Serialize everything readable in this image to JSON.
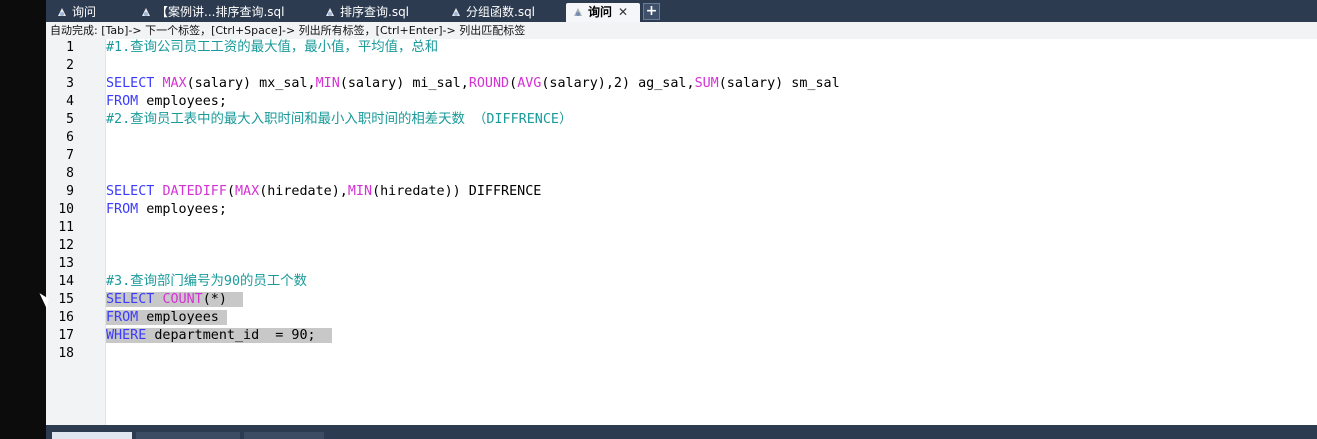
{
  "tabs": [
    {
      "label": "询问",
      "icon": "query-file-icon"
    },
    {
      "label": "【案例讲...排序查询.sql",
      "icon": "query-file-icon"
    },
    {
      "label": "排序查询.sql",
      "icon": "query-file-icon"
    },
    {
      "label": "分组函数.sql",
      "icon": "query-file-icon"
    },
    {
      "label": "询问",
      "icon": "query-file-icon",
      "active": true,
      "close": "✕"
    }
  ],
  "new_tab_label": "+",
  "hint_bar": "自动完成: [Tab]-> 下一个标签，[Ctrl+Space]-> 列出所有标签，[Ctrl+Enter]-> 列出匹配标签",
  "editor": {
    "line_numbers": [
      "1",
      "2",
      "3",
      "4",
      "5",
      "6",
      "7",
      "8",
      "9",
      "10",
      "11",
      "12",
      "13",
      "14",
      "15",
      "16",
      "17",
      "18"
    ],
    "lines": {
      "l1": "#1.查询公司员工工资的最大值，最小值，平均值，总和",
      "l3": {
        "kw": "SELECT ",
        "f1": "MAX",
        "t1": "(salary) mx_sal,",
        "f2": "MIN",
        "t2": "(salary) mi_sal,",
        "f3": "ROUND",
        "t3": "(",
        "f4": "AVG",
        "t4": "(salary),2) ag_sal,",
        "f5": "SUM",
        "t5": "(salary) sm_sal"
      },
      "l4": {
        "kw": "FROM",
        "t": " employees;"
      },
      "l5": "#2.查询员工表中的最大入职时间和最小入职时间的相差天数 （DIFFRENCE）",
      "l9": {
        "kw": "SELECT ",
        "f1": "DATEDIFF",
        "t1": "(",
        "f2": "MAX",
        "t2": "(hiredate),",
        "f3": "MIN",
        "t3": "(hiredate)) DIFFRENCE"
      },
      "l10": {
        "kw": "FROM",
        "t": " employees;"
      },
      "l14": "#3.查询部门编号为90的员工个数",
      "l15": {
        "kw": "SELECT ",
        "f1": "COUNT",
        "t1": "(*)"
      },
      "l16": {
        "kw": "FROM",
        "t": " employees"
      },
      "l17": {
        "kw": "WHERE",
        "t": " department_id  = 90;"
      }
    }
  },
  "colors": {
    "keyword": "#3b3bff",
    "function": "#d433d4",
    "comment": "#1a9a9a",
    "selection": "#c8c8c8",
    "tab_bar": "#2c3b50"
  }
}
